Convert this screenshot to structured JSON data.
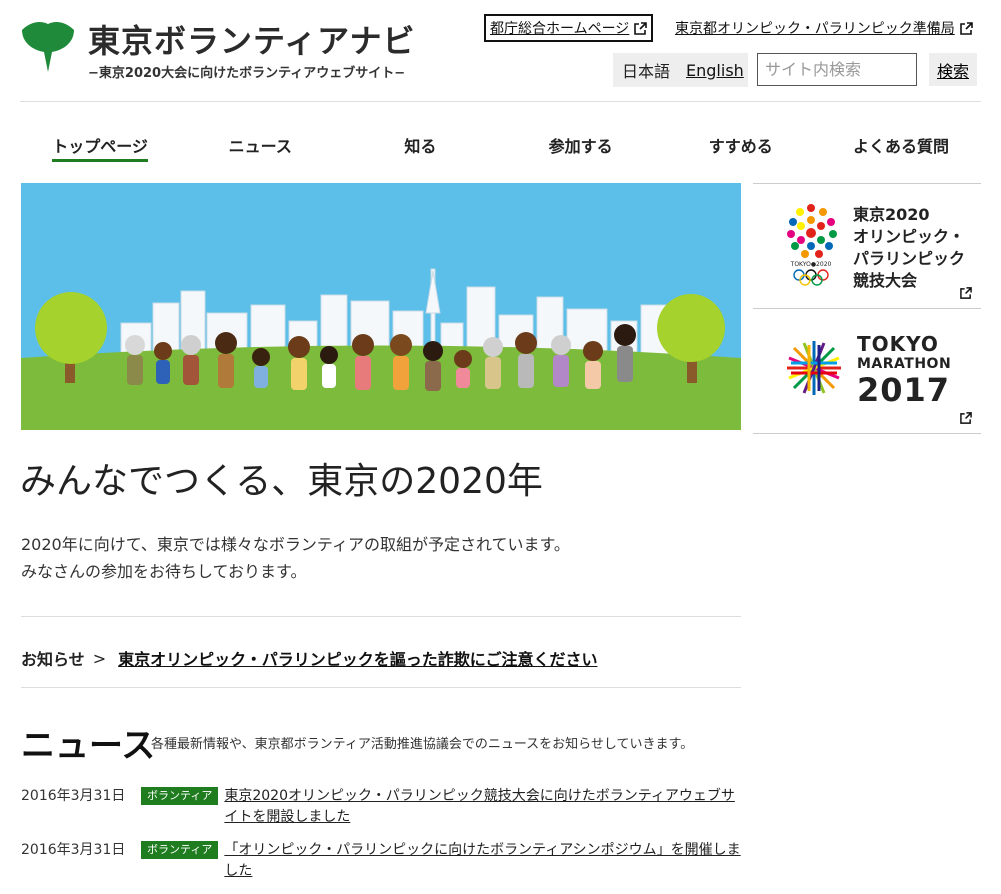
{
  "header": {
    "site_title": "東京ボランティアナビ",
    "site_subtitle": "−東京2020大会に向けたボランティアウェブサイト−",
    "links": {
      "govt_home": "都庁総合ホームページ",
      "prep_bureau": "東京都オリンピック・パラリンピック準備局"
    },
    "languages": {
      "japanese": "日本語",
      "english": "English"
    },
    "search": {
      "placeholder": "サイト内検索",
      "button": "検索"
    },
    "logo_color": "#1f8b3a"
  },
  "nav": {
    "items": [
      {
        "label": "トップページ",
        "active": true
      },
      {
        "label": "ニュース"
      },
      {
        "label": "知る"
      },
      {
        "label": "参加する"
      },
      {
        "label": "すすめる"
      },
      {
        "label": "よくある質問"
      }
    ],
    "active_color": "#1f7d1f"
  },
  "hero": {
    "sky_color": "#5bbfe9",
    "grass_color": "#7dbb3c"
  },
  "side": {
    "olympic": {
      "text_lines": [
        "東京2020",
        "オリンピック・",
        "パラリンピック",
        "競技大会"
      ],
      "emblem_caption": "TOKYO●2020"
    },
    "marathon": {
      "line1": "TOKYO",
      "line2": "MARATHON",
      "line3": "2017"
    }
  },
  "main": {
    "heading": "みんなでつくる、東京の2020年",
    "intro_line1": "2020年に向けて、東京では様々なボランティアの取組が予定されています。",
    "intro_line2": "みなさんの参加をお待ちしております。",
    "notice": {
      "label": "お知らせ",
      "chevron": ">",
      "link": "東京オリンピック・パラリンピックを謳った詐欺にご注意ください"
    }
  },
  "news": {
    "title": "ニュース",
    "description": "各種最新情報や、東京都ボランティア活動推進協議会でのニュースをお知らせしていきます。",
    "items": [
      {
        "date": "2016年3月31日",
        "badge": "ボランティア",
        "title": "東京2020オリンピック・パラリンピック競技大会に向けたボランティアウェブサイトを開設しました"
      },
      {
        "date": "2016年3月31日",
        "badge": "ボランティア",
        "title": "「オリンピック・パラリンピックに向けたボランティアシンポジウム」を開催しました"
      }
    ],
    "badge_color": "#1f7d1f"
  }
}
